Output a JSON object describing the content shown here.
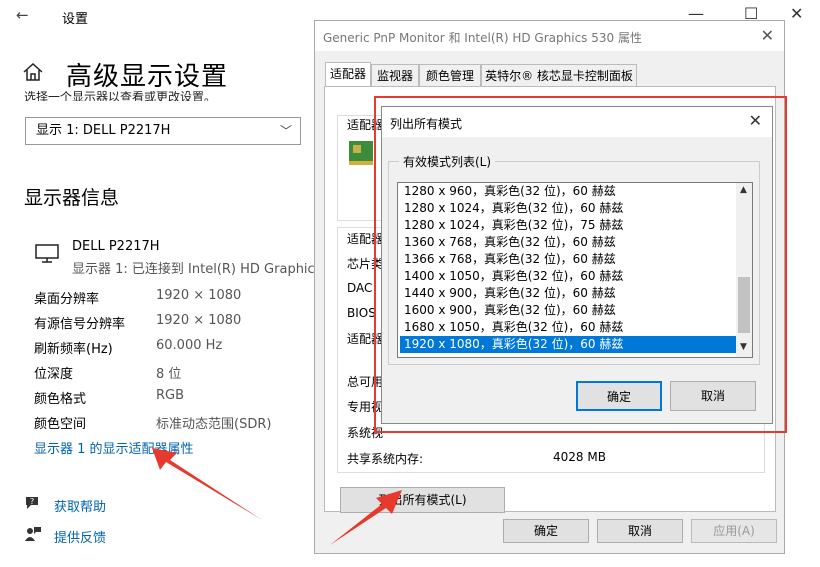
{
  "settings": {
    "window_title": "设置",
    "page_title": "高级显示设置",
    "cut_text": "选择一个显示器以查看或更改设置。",
    "dropdown_value": "显示 1: DELL P2217H",
    "section_title": "显示器信息",
    "monitor_name": "DELL P2217H",
    "monitor_sub": "显示器 1: 已连接到 Intel(R) HD Graphics",
    "info": [
      {
        "label": "桌面分辨率",
        "value": "1920 × 1080"
      },
      {
        "label": "有源信号分辨率",
        "value": "1920 × 1080"
      },
      {
        "label": "刷新频率(Hz)",
        "value": "60.000 Hz"
      },
      {
        "label": "位深度",
        "value": "8 位"
      },
      {
        "label": "颜色格式",
        "value": "RGB"
      },
      {
        "label": "颜色空间",
        "value": "标准动态范围(SDR)"
      }
    ],
    "adapter_link": "显示器 1 的显示适配器属性",
    "help": "获取帮助",
    "feedback": "提供反馈",
    "controls": {
      "minimize": "—",
      "maximize": "☐",
      "close": "✕"
    }
  },
  "properties": {
    "title": "Generic PnP Monitor 和 Intel(R) HD Graphics 530 属性",
    "tabs": [
      "适配器",
      "监视器",
      "颜色管理",
      "英特尔® 核芯显卡控制面板"
    ],
    "adapter_type_label": "适配器类型",
    "adapter_info_label": "适配器",
    "info_labels": [
      "芯片类",
      "DAC",
      "BIOS",
      "适配器"
    ],
    "mem_labels": [
      "总可用",
      "专用视",
      "系统视"
    ],
    "shared_mem_label": "共享系统内存:",
    "shared_mem_value": "4028 MB",
    "list_all_button": "列出所有模式(L)",
    "ok": "确定",
    "cancel": "取消",
    "apply": "应用(A)"
  },
  "list_modes": {
    "title": "列出所有模式",
    "group_label": "有效模式列表(L)",
    "modes": [
      "1280 x 960，真彩色(32 位)，60 赫兹",
      "1280 x 1024，真彩色(32 位)，60 赫兹",
      "1280 x 1024，真彩色(32 位)，75 赫兹",
      "1360 x 768，真彩色(32 位)，60 赫兹",
      "1366 x 768，真彩色(32 位)，60 赫兹",
      "1400 x 1050，真彩色(32 位)，60 赫兹",
      "1440 x 900，真彩色(32 位)，60 赫兹",
      "1600 x 900，真彩色(32 位)，60 赫兹",
      "1680 x 1050，真彩色(32 位)，60 赫兹",
      "1920 x 1080，真彩色(32 位)，60 赫兹"
    ],
    "selected_index": 9,
    "ok": "确定",
    "cancel": "取消"
  },
  "colors": {
    "accent": "#0078d7",
    "link": "#0063b1",
    "annotation": "#e63a2e"
  }
}
